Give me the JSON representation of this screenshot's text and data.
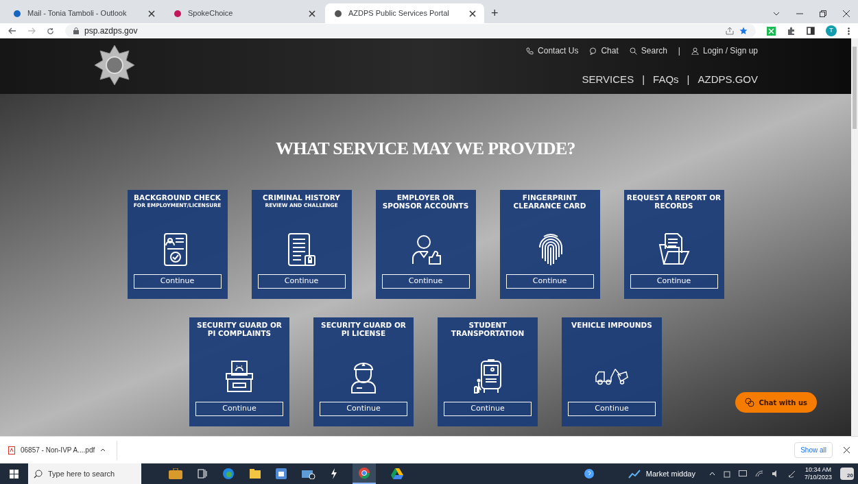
{
  "browser": {
    "tabs": [
      {
        "title": "Mail - Tonia Tamboli - Outlook",
        "selected": false
      },
      {
        "title": "SpokeChoice",
        "selected": false
      },
      {
        "title": "AZDPS Public Services Portal",
        "selected": true
      }
    ],
    "new_tab": "+",
    "url": "psp.azdps.gov",
    "profile": "T"
  },
  "header": {
    "utility_links": [
      {
        "kind": "phone",
        "label": "Contact Us"
      },
      {
        "kind": "chat",
        "label": "Chat"
      },
      {
        "kind": "search",
        "label": "Search"
      },
      {
        "kind": "user",
        "label": "Login / Sign up"
      }
    ],
    "utility_separator": "|",
    "nav": [
      "SERVICES",
      "FAQs",
      "AZDPS.GOV"
    ],
    "nav_separator": "|"
  },
  "hero": {
    "heading": "WHAT SERVICE MAY WE PROVIDE?",
    "rows": [
      [
        {
          "title": "BACKGROUND CHECK",
          "subtitle": "FOR EMPLOYMENT/LICENSURE",
          "button": "Continue"
        },
        {
          "title": "CRIMINAL HISTORY",
          "subtitle": "REVIEW AND CHALLENGE",
          "button": "Continue"
        },
        {
          "title": "EMPLOYER OR SPONSOR ACCOUNTS",
          "button": "Continue"
        },
        {
          "title": "FINGERPRINT CLEARANCE CARD",
          "button": "Continue"
        },
        {
          "title": "REQUEST A REPORT OR RECORDS",
          "button": "Continue"
        }
      ],
      [
        {
          "title": "SECURITY GUARD OR PI COMPLAINTS",
          "button": "Continue"
        },
        {
          "title": "SECURITY GUARD OR PI LICENSE",
          "button": "Continue"
        },
        {
          "title": "STUDENT TRANSPORTATION",
          "button": "Continue"
        },
        {
          "title": "VEHICLE IMPOUNDS",
          "button": "Continue"
        }
      ]
    ],
    "chat_button": "Chat with us"
  },
  "download_bar": {
    "file": "06857 - Non-IVP A....pdf",
    "show_all": "Show all"
  },
  "taskbar": {
    "search_placeholder": "Type here to search",
    "weather": "Market midday",
    "time": "10:34 AM",
    "date": "7/10/2023",
    "notifications": "20"
  }
}
